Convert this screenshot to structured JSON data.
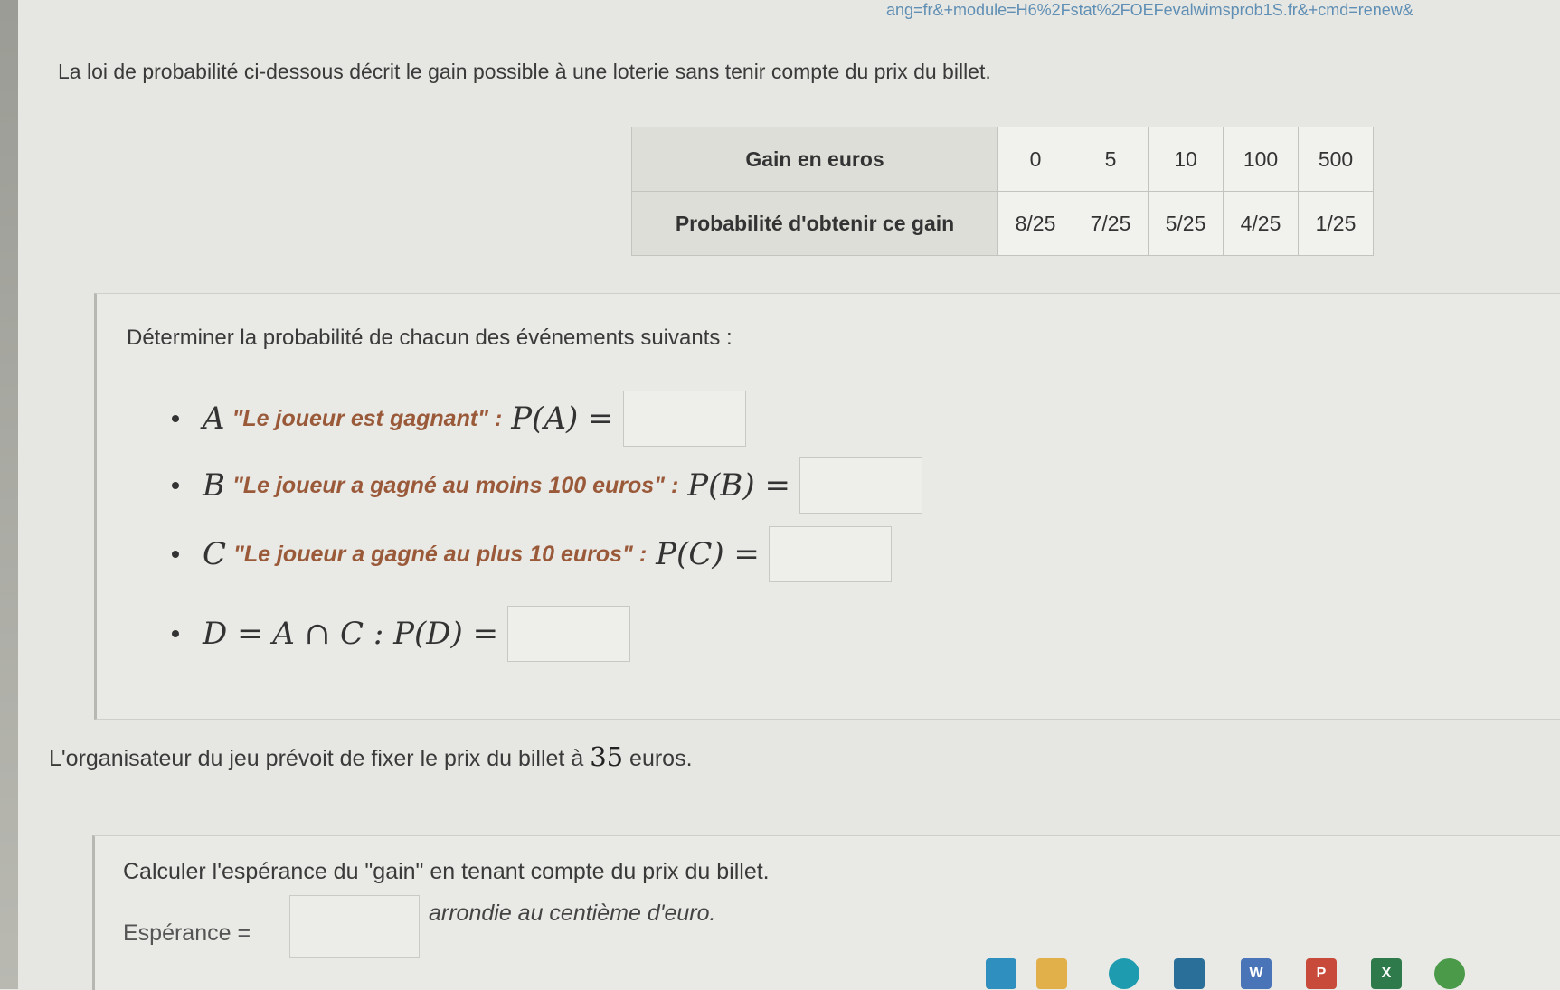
{
  "browser": {
    "url_fragment": "ang=fr&+module=H6%2Fstat%2FOEFevalwimsprob1S.fr&+cmd=renew&"
  },
  "intro_text": "La loi de probabilité ci-dessous décrit le gain possible à une loterie sans tenir compte du prix du billet.",
  "table": {
    "row1_header": "Gain en euros",
    "row1": [
      "0",
      "5",
      "10",
      "100",
      "500"
    ],
    "row2_header": "Probabilité d'obtenir ce gain",
    "row2": [
      "8/25",
      "7/25",
      "5/25",
      "4/25",
      "1/25"
    ]
  },
  "question1": "Déterminer la probabilité de chacun des événements suivants :",
  "events": [
    {
      "letter": "A",
      "description": "\"Le joueur est gagnant\" :",
      "math": "P(A) =",
      "answer": ""
    },
    {
      "letter": "B",
      "description": "\"Le joueur a gagné au moins 100 euros\" :",
      "math": "P(B) =",
      "answer": ""
    },
    {
      "letter": "C",
      "description": "\"Le joueur a gagné au plus 10 euros\" :",
      "math": "P(C) =",
      "answer": ""
    },
    {
      "letter": "",
      "description": "",
      "math": "D = A ∩ C : P(D) =",
      "answer": ""
    }
  ],
  "sentence2_before": "L'organisateur du jeu prévoit de fixer le prix du billet à",
  "sentence2_number": "35",
  "sentence2_after": "euros.",
  "question2": "Calculer l'espérance du \"gain\" en tenant compte du prix du billet.",
  "esperance_label": "Espérance =",
  "esperance_value": "",
  "esperance_note": "arrondie au centième d'euro.",
  "taskbar_icons": [
    "files-icon",
    "folder-icon",
    "edge-icon",
    "store-icon",
    "word-icon",
    "powerpoint-icon",
    "excel-icon",
    "chrome-icon"
  ],
  "taskbar_letters": {
    "word": "W",
    "powerpoint": "P",
    "excel": "X"
  }
}
